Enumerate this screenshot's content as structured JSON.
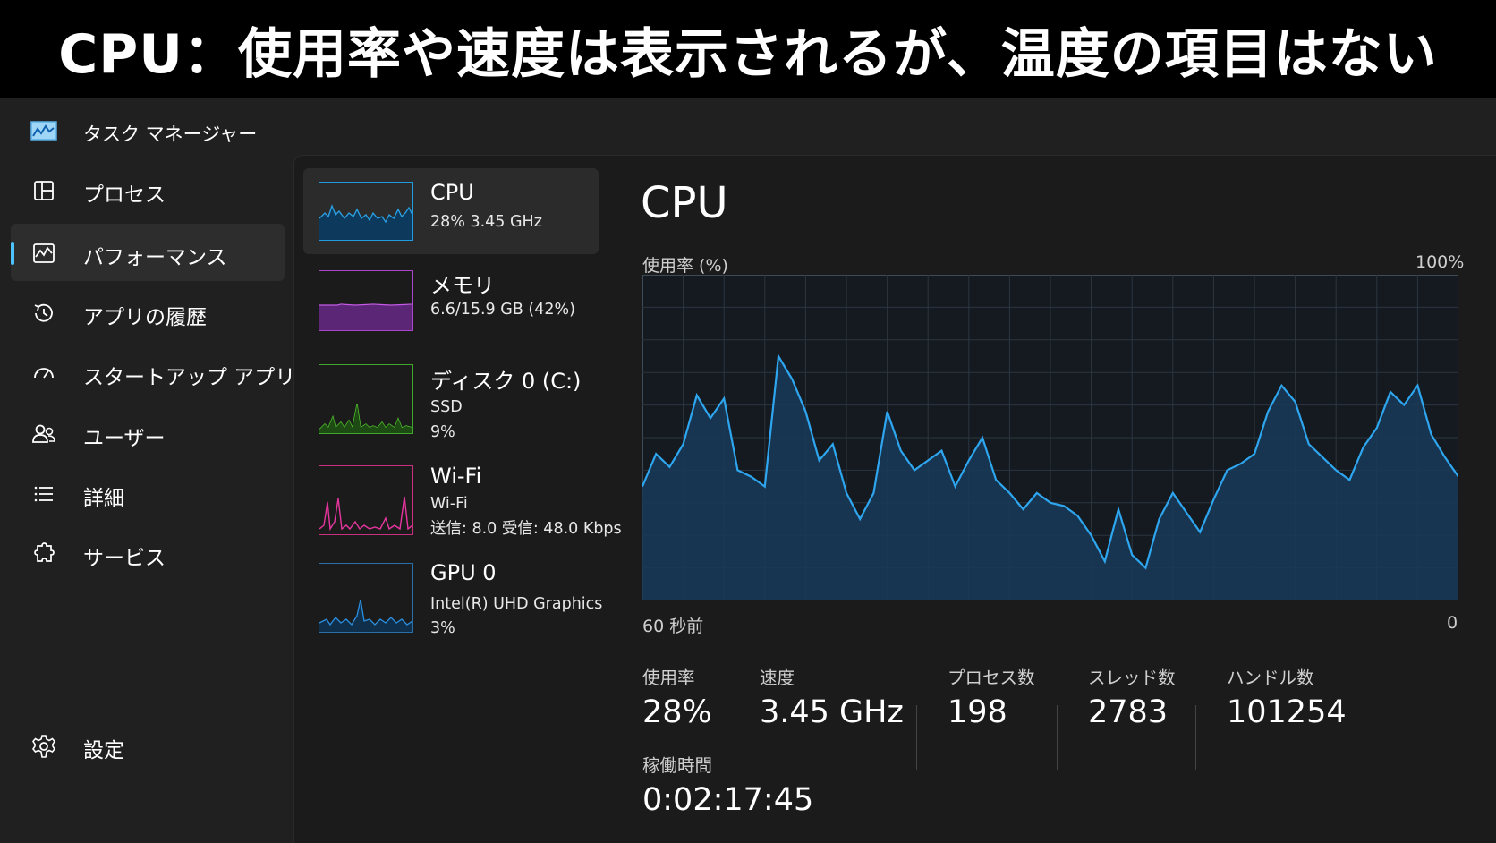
{
  "banner": {
    "text": "CPU：使用率や速度は表示されるが、温度の項目はない"
  },
  "app": {
    "title": "タスク マネージャー"
  },
  "nav": {
    "items": [
      {
        "label": "プロセス"
      },
      {
        "label": "パフォーマンス"
      },
      {
        "label": "アプリの履歴"
      },
      {
        "label": "スタートアップ アプリ"
      },
      {
        "label": "ユーザー"
      },
      {
        "label": "詳細"
      },
      {
        "label": "サービス"
      }
    ],
    "settings": "設定"
  },
  "devices": [
    {
      "name": "CPU",
      "line1": "28%  3.45 GHz",
      "line2": ""
    },
    {
      "name": "メモリ",
      "line1": "6.6/15.9 GB (42%)",
      "line2": ""
    },
    {
      "name": "ディスク 0 (C:)",
      "line1": "SSD",
      "line2": "9%"
    },
    {
      "name": "Wi-Fi",
      "line1": "Wi-Fi",
      "line2": "送信: 8.0  受信: 48.0 Kbps"
    },
    {
      "name": "GPU 0",
      "line1": "Intel(R) UHD Graphics",
      "line2": "3%"
    }
  ],
  "detail": {
    "title": "CPU",
    "y_label": "使用率 (%)",
    "y_max": "100%",
    "x_left": "60 秒前",
    "x_right": "0",
    "stats": [
      {
        "label": "使用率",
        "value": "28%"
      },
      {
        "label": "速度",
        "value": "3.45 GHz"
      },
      {
        "label": "プロセス数",
        "value": "198"
      },
      {
        "label": "スレッド数",
        "value": "2783"
      },
      {
        "label": "ハンドル数",
        "value": "101254"
      }
    ],
    "uptime_label": "稼働時間",
    "uptime_value": "0:02:17:45"
  },
  "colors": {
    "accent": "#4cc2ff",
    "cpu": "#1f9bde",
    "memory": "#b44bd8",
    "disk": "#4fc22e",
    "wifi": "#e0349b",
    "gpu": "#2b8fe0"
  },
  "chart_data": {
    "type": "area",
    "ylim": [
      0,
      100
    ],
    "xlim": [
      60,
      0
    ],
    "x": [
      60,
      59,
      58,
      57,
      56,
      55,
      54,
      53,
      52,
      51,
      50,
      49,
      48,
      47,
      46,
      45,
      44,
      43,
      42,
      41,
      40,
      39,
      38,
      37,
      36,
      35,
      34,
      33,
      32,
      31,
      30,
      29,
      28,
      27,
      26,
      25,
      24,
      23,
      22,
      21,
      20,
      19,
      18,
      17,
      16,
      15,
      14,
      13,
      12,
      11,
      10,
      9,
      8,
      7,
      6,
      5,
      4,
      3,
      2,
      1,
      0
    ],
    "series": [
      {
        "values": [
          35,
          45,
          41,
          48,
          63,
          56,
          62,
          40,
          38,
          35,
          75,
          68,
          58,
          43,
          48,
          33,
          25,
          33,
          58,
          46,
          40,
          43,
          46,
          35,
          43,
          50,
          37,
          33,
          28,
          33,
          30,
          29,
          26,
          20,
          12,
          28,
          14,
          10,
          25,
          33,
          27,
          21,
          31,
          40,
          42,
          45,
          58,
          66,
          61,
          48,
          44,
          40,
          37,
          47,
          53,
          64,
          60,
          66,
          51,
          44,
          38
        ]
      }
    ]
  }
}
